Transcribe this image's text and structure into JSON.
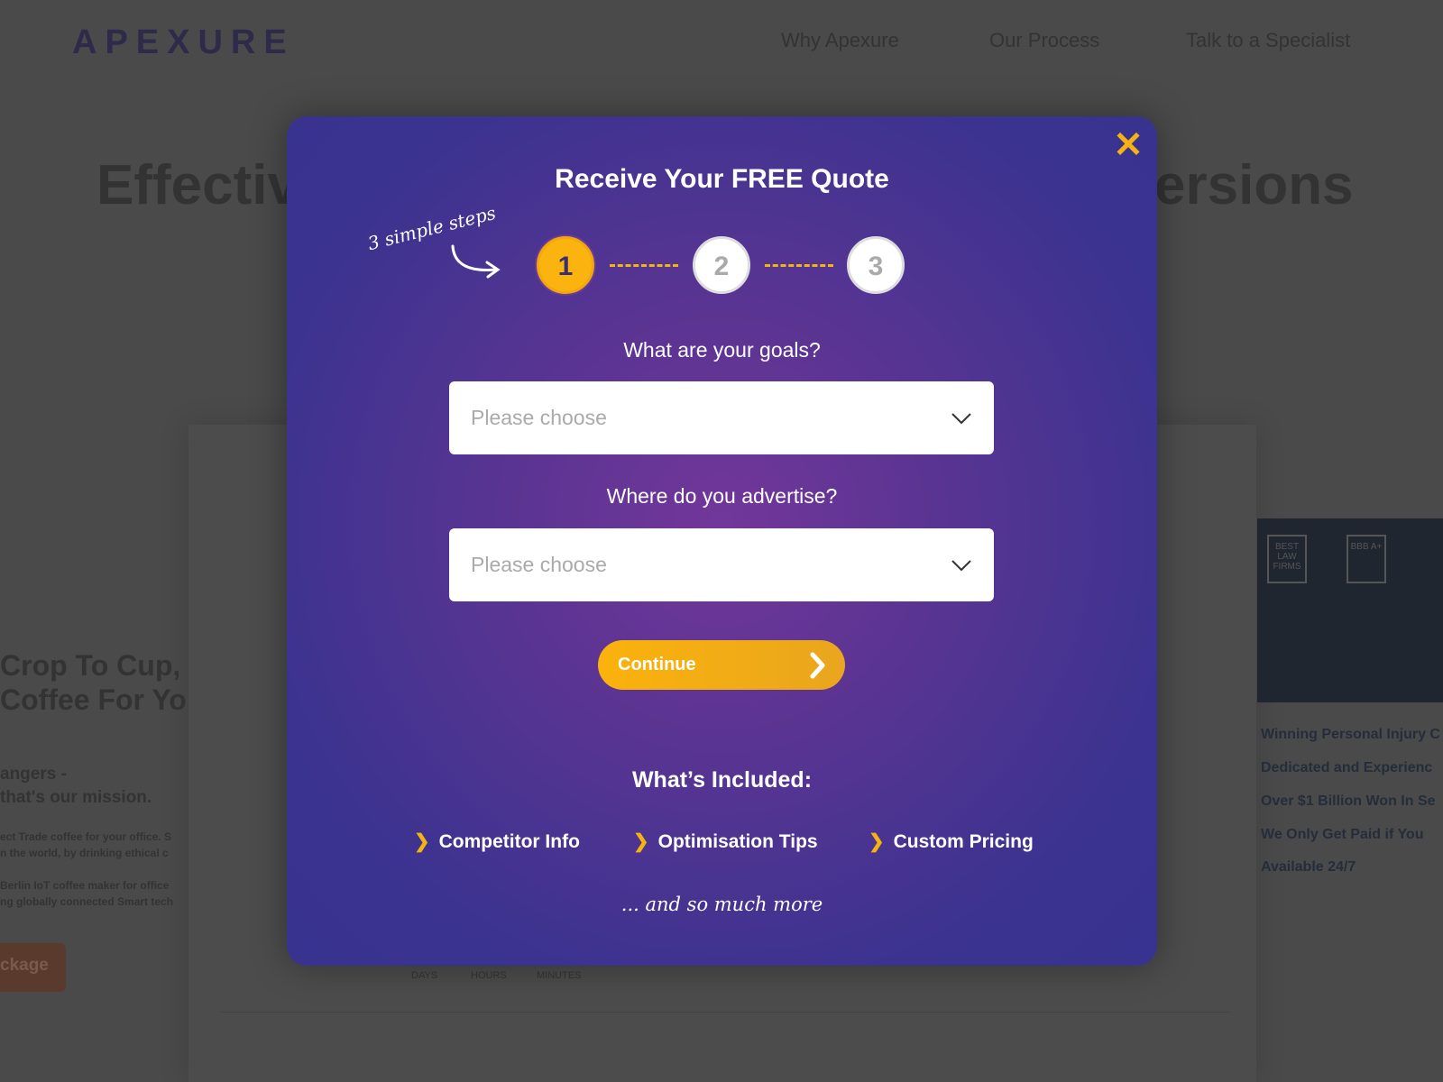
{
  "header": {
    "logo": "APEXURE",
    "nav": [
      "Why Apexure",
      "Our Process",
      "Talk to a Specialist"
    ]
  },
  "background": {
    "hero_left": "Effectiv",
    "hero_right": "ersions",
    "left_heading": [
      "Crop To Cup,",
      "Coffee For Yo"
    ],
    "left_sub": [
      "angers -",
      " that's our mission."
    ],
    "left_body": [
      "ect Trade coffee for your office. S",
      "n the world, by drinking ethical c",
      "Berlin IoT coffee maker for office",
      "ng globally connected Smart tech"
    ],
    "package_button": "ckage",
    "timer_labels": [
      "DAYS",
      "HOURS",
      "MINUTES"
    ],
    "badges": [
      "BEST LAW FIRMS",
      "BBB A+"
    ],
    "right_list": [
      "Winning Personal Injury C",
      "Dedicated and Experienc",
      "Over $1 Billion Won In Se",
      "We Only Get Paid if You",
      "Available 24/7"
    ]
  },
  "modal": {
    "title": "Receive Your FREE Quote",
    "steps_note": "3 simple steps",
    "steps": [
      "1",
      "2",
      "3"
    ],
    "active_step": 1,
    "q1": "What are your goals?",
    "q1_placeholder": "Please choose",
    "q2": "Where do you advertise?",
    "q2_placeholder": "Please choose",
    "continue": "Continue",
    "included_title": "What’s Included:",
    "included": [
      "Competitor Info",
      "Optimisation Tips",
      "Custom Pricing"
    ],
    "more": "... and so much more",
    "colors": {
      "accent": "#fbb30f",
      "modal": "#3c3390"
    }
  }
}
